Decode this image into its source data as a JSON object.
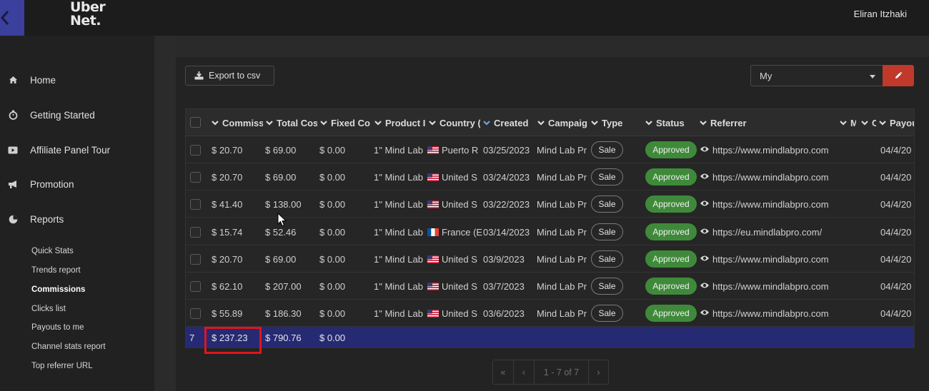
{
  "header": {
    "logo_line1": "Uber",
    "logo_line2": "Net.",
    "user_name": "Eliran Itzhaki"
  },
  "sidebar": {
    "items": [
      {
        "label": "Home",
        "icon": "home-icon"
      },
      {
        "label": "Getting Started",
        "icon": "stopwatch-icon"
      },
      {
        "label": "Affiliate Panel Tour",
        "icon": "video-icon"
      },
      {
        "label": "Promotion",
        "icon": "bullhorn-icon"
      },
      {
        "label": "Reports",
        "icon": "pie-chart-icon"
      }
    ],
    "sub_items": [
      "Quick Stats",
      "Trends report",
      "Commissions",
      "Clicks list",
      "Payouts to me",
      "Channel stats report",
      "Top referrer URL"
    ],
    "active_sub_item": "Commissions"
  },
  "toolbar": {
    "export_label": "Export to csv",
    "select_value": "My"
  },
  "table": {
    "columns": [
      "Commiss",
      "Total Cos",
      "Fixed Co",
      "Product I",
      "Country (",
      "Created",
      "Campaig",
      "Type",
      "Status",
      "Referrer",
      "M",
      "C",
      "Payou"
    ],
    "rows": [
      {
        "commission": "$ 20.70",
        "total_cost": "$ 69.00",
        "fixed_cost": "$ 0.00",
        "product": "1\" Mind Lab",
        "country": "Puerto R",
        "flag": "us",
        "created": "03/25/2023",
        "campaign": "Mind Lab Pr",
        "type": "Sale",
        "status": "Approved",
        "referrer": "https://www.mindlabpro.com",
        "payout": "04/4/20"
      },
      {
        "commission": "$ 20.70",
        "total_cost": "$ 69.00",
        "fixed_cost": "$ 0.00",
        "product": "1\" Mind Lab",
        "country": "United S",
        "flag": "us",
        "created": "03/24/2023",
        "campaign": "Mind Lab Pr",
        "type": "Sale",
        "status": "Approved",
        "referrer": "https://www.mindlabpro.com",
        "payout": "04/4/20"
      },
      {
        "commission": "$ 41.40",
        "total_cost": "$ 138.00",
        "fixed_cost": "$ 0.00",
        "product": "1\" Mind Lab",
        "country": "United S",
        "flag": "us",
        "created": "03/22/2023",
        "campaign": "Mind Lab Pr",
        "type": "Sale",
        "status": "Approved",
        "referrer": "https://www.mindlabpro.com",
        "payout": "04/4/20"
      },
      {
        "commission": "$ 15.74",
        "total_cost": "$ 52.46",
        "fixed_cost": "$ 0.00",
        "product": "1\" Mind Lab",
        "country": "France (E",
        "flag": "fr",
        "created": "03/14/2023",
        "campaign": "Mind Lab Pr",
        "type": "Sale",
        "status": "Approved",
        "referrer": "https://eu.mindlabpro.com/",
        "payout": "04/4/20"
      },
      {
        "commission": "$ 20.70",
        "total_cost": "$ 69.00",
        "fixed_cost": "$ 0.00",
        "product": "1\" Mind Lab",
        "country": "United S",
        "flag": "us",
        "created": "03/9/2023",
        "campaign": "Mind Lab Pr",
        "type": "Sale",
        "status": "Approved",
        "referrer": "https://www.mindlabpro.com",
        "payout": "04/4/20"
      },
      {
        "commission": "$ 62.10",
        "total_cost": "$ 207.00",
        "fixed_cost": "$ 0.00",
        "product": "1\" Mind Lab",
        "country": "United S",
        "flag": "us",
        "created": "03/7/2023",
        "campaign": "Mind Lab Pr",
        "type": "Sale",
        "status": "Approved",
        "referrer": "https://www.mindlabpro.com",
        "payout": "04/4/20"
      },
      {
        "commission": "$ 55.89",
        "total_cost": "$ 186.30",
        "fixed_cost": "$ 0.00",
        "product": "1\" Mind Lab",
        "country": "United S",
        "flag": "us",
        "created": "03/6/2023",
        "campaign": "Mind Lab Pr",
        "type": "Sale",
        "status": "Approved",
        "referrer": "https://www.mindlabpro.com",
        "payout": "04/4/20"
      }
    ],
    "totals": {
      "count": "7",
      "commission": "$ 237.23",
      "total_cost": "$ 790.76",
      "fixed_cost": "$ 0.00"
    }
  },
  "pagination": {
    "first": "«",
    "prev": "‹",
    "range": "1 - 7 of 7",
    "next": "›"
  },
  "colors": {
    "accent": "#3b3f9e",
    "total_row": "#262a72",
    "approved": "#3f8a3a",
    "edit_button": "#c0392b",
    "highlight_box": "#e0141e"
  }
}
